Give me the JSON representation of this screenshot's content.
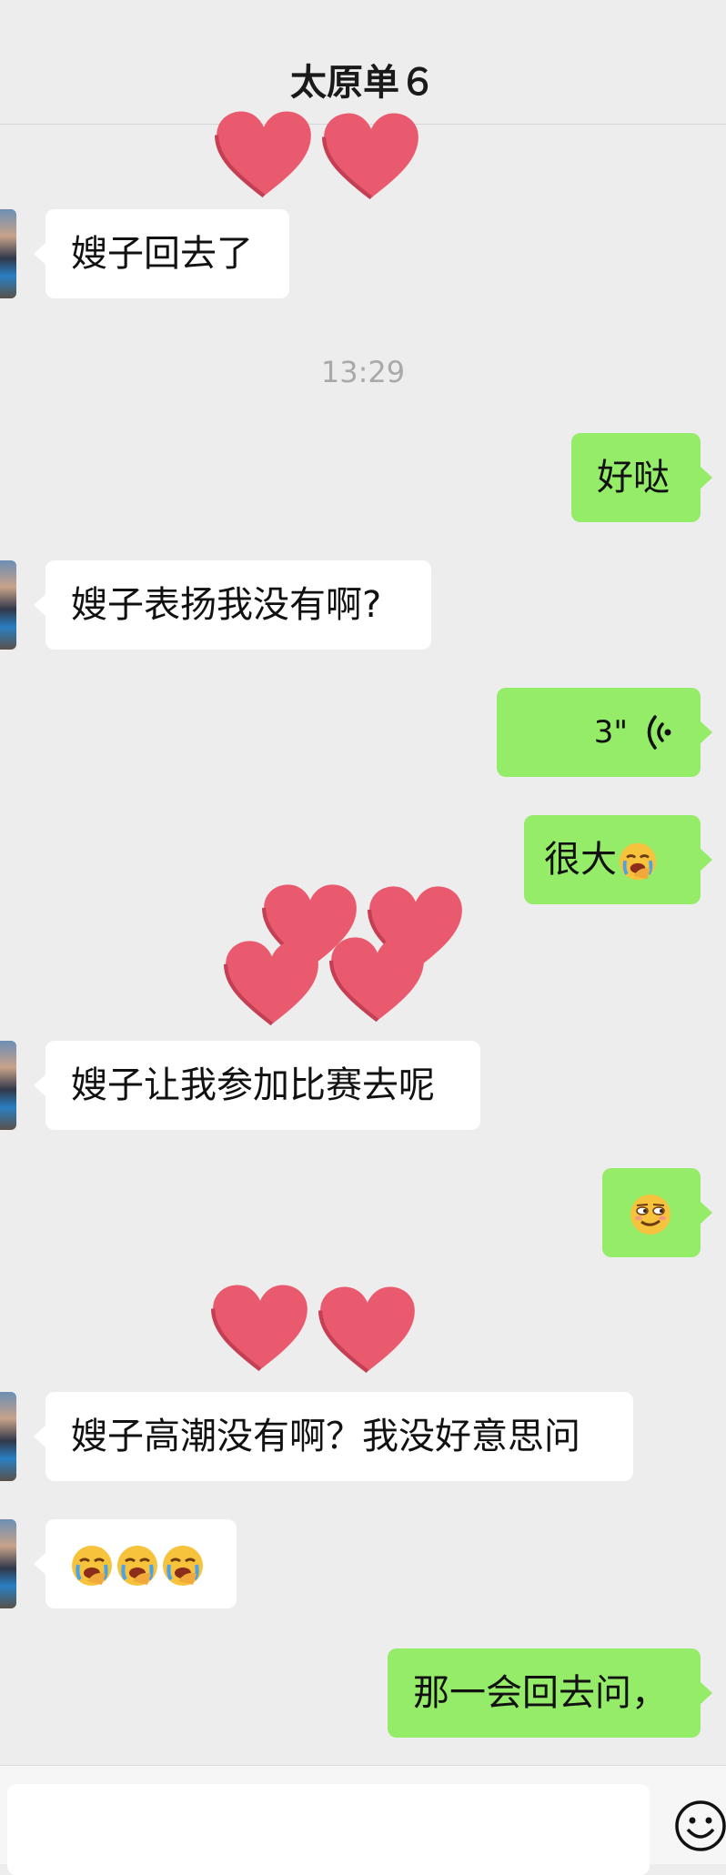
{
  "header": {
    "title": "太原单６"
  },
  "timestamp": "13:29",
  "messages": [
    {
      "dir": "in",
      "text": "嫂子回去了"
    },
    {
      "dir": "out",
      "text": "好哒"
    },
    {
      "dir": "in",
      "text": "嫂子表扬我没有啊?"
    },
    {
      "dir": "out",
      "type": "voice",
      "duration": "3\""
    },
    {
      "dir": "out",
      "text": "很大",
      "emoji": "face-palm-cry"
    },
    {
      "dir": "in",
      "text": "嫂子让我参加比赛去呢"
    },
    {
      "dir": "out",
      "emoji": "smirk-face"
    },
    {
      "dir": "in",
      "text": "嫂子高潮没有啊？我没好意思问"
    },
    {
      "dir": "in",
      "emoji": "face-palm-cry x3"
    },
    {
      "dir": "out",
      "text": "那一会回去问，"
    }
  ],
  "input": {
    "placeholder": ""
  },
  "icons": {
    "voice": "voice-wave-icon",
    "emoji_button": "smiley-icon",
    "stickers": "heart-sticker"
  },
  "colors": {
    "incoming": "#ffffff",
    "outgoing": "#95ec69",
    "background": "#ededed",
    "heart": "#e95a6f"
  }
}
